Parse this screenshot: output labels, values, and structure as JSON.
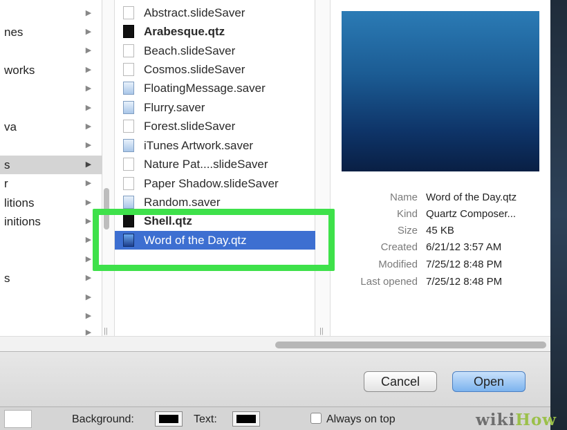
{
  "sidebar": {
    "items": [
      {
        "label": "nes"
      },
      {
        "label": "works"
      },
      {
        "label": "va"
      },
      {
        "label": "s"
      },
      {
        "label": "r"
      },
      {
        "label": "litions"
      },
      {
        "label": "initions"
      },
      {
        "label": "s"
      }
    ]
  },
  "files": [
    {
      "name": "Abstract.slideSaver",
      "icon": "document-icon"
    },
    {
      "name": "Arabesque.qtz",
      "icon": "quartz-composition-icon"
    },
    {
      "name": "Beach.slideSaver",
      "icon": "document-icon"
    },
    {
      "name": "Cosmos.slideSaver",
      "icon": "document-icon"
    },
    {
      "name": "FloatingMessage.saver",
      "icon": "screensaver-bundle-icon"
    },
    {
      "name": "Flurry.saver",
      "icon": "screensaver-bundle-icon"
    },
    {
      "name": "Forest.slideSaver",
      "icon": "document-icon"
    },
    {
      "name": "iTunes Artwork.saver",
      "icon": "screensaver-bundle-icon"
    },
    {
      "name": "Nature Pat....slideSaver",
      "icon": "document-icon"
    },
    {
      "name": "Paper Shadow.slideSaver",
      "icon": "document-icon"
    },
    {
      "name": "Random.saver",
      "icon": "screensaver-bundle-icon"
    },
    {
      "name": "Shell.qtz",
      "icon": "quartz-composition-icon"
    },
    {
      "name": "Word of the Day.qtz",
      "icon": "quartz-composition-icon",
      "selected": true
    }
  ],
  "info": {
    "rows": [
      {
        "label": "Name",
        "value": "Word of the Day.qtz"
      },
      {
        "label": "Kind",
        "value": "Quartz Composer..."
      },
      {
        "label": "Size",
        "value": "45 KB"
      },
      {
        "label": "Created",
        "value": "6/21/12 3:57 AM"
      },
      {
        "label": "Modified",
        "value": "7/25/12 8:48 PM"
      },
      {
        "label": "Last opened",
        "value": "7/25/12 8:48 PM"
      }
    ]
  },
  "buttons": {
    "cancel": "Cancel",
    "open": "Open"
  },
  "bottom": {
    "background_label": "Background:",
    "text_label": "Text:",
    "always_on_top": "Always on top"
  },
  "watermark": {
    "wiki": "wiki",
    "how": "How"
  },
  "colors": {
    "selection": "#3d6fd1",
    "highlight_frame": "#3ee14a",
    "open_button": "#7cb3ee"
  }
}
